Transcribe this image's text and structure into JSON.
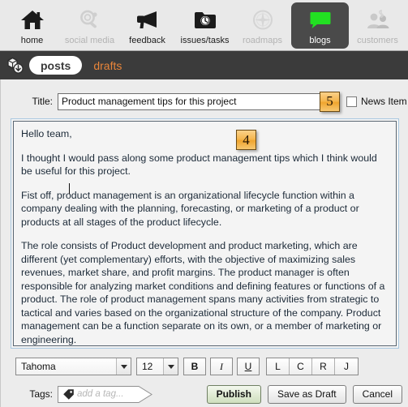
{
  "nav": {
    "items": [
      {
        "id": "home",
        "label": "home",
        "icon": "house-icon",
        "state": "normal"
      },
      {
        "id": "social-media",
        "label": "social media",
        "icon": "magnifier-icon",
        "state": "disabled"
      },
      {
        "id": "feedback",
        "label": "feedback",
        "icon": "megaphone-icon",
        "state": "normal"
      },
      {
        "id": "issues-tasks",
        "label": "issues/tasks",
        "icon": "folder-clock-icon",
        "state": "normal"
      },
      {
        "id": "roadmaps",
        "label": "roadmaps",
        "icon": "compass-icon",
        "state": "disabled"
      },
      {
        "id": "blogs",
        "label": "blogs",
        "icon": "speech-bubble-icon",
        "state": "active"
      },
      {
        "id": "customers",
        "label": "customers",
        "icon": "people-icon",
        "state": "disabled"
      }
    ]
  },
  "tabstrip": {
    "icon": "package-download-icon",
    "tabs": [
      {
        "id": "posts",
        "label": "posts",
        "selected": true
      },
      {
        "id": "drafts",
        "label": "drafts",
        "selected": false
      }
    ]
  },
  "form": {
    "title_label": "Title:",
    "title_value": "Product management tips for this project",
    "title_placeholder": "Enter a title...",
    "news_item_label": "News Item",
    "news_item_checked": false,
    "tags_label": "Tags:",
    "tags_value": "",
    "tags_placeholder": "add a tag..."
  },
  "badges": [
    {
      "id": "badge-5",
      "value": "5"
    },
    {
      "id": "badge-4",
      "value": "4"
    }
  ],
  "body": {
    "paragraphs": [
      "Hello team,",
      "I thought I would pass along some product management tips which I think would be useful for this project.",
      "Fist off, product management is an organizational lifecycle function within a company dealing with the planning, forecasting, or marketing of a product or products at all stages of the product lifecycle.",
      "The role consists of Product development and product marketing, which are different (yet complementary) efforts, with the objective of maximizing sales revenues, market share, and profit margins. The product manager is often responsible for analyzing market conditions and defining features or functions of a product. The role of product management spans many activities from strategic to tactical and varies based on the organizational structure of the company. Product management can be a function separate on its own, or a member of marketing or engineering."
    ]
  },
  "format_bar": {
    "font_family_value": "Tahoma",
    "font_size_value": "12",
    "bold_label": "B",
    "italic_label": "I",
    "underline_label": "U",
    "align_left_label": "L",
    "align_center_label": "C",
    "align_right_label": "R",
    "align_justify_label": "J"
  },
  "actions": {
    "publish_label": "Publish",
    "save_draft_label": "Save as Draft",
    "cancel_label": "Cancel"
  },
  "colors": {
    "accent_orange": "#e8853a",
    "badge_gold": "#f5b750",
    "active_nav_bg": "#4a4a4a",
    "blog_green": "#22e022",
    "tabstrip_bg": "#3b3b3b"
  }
}
